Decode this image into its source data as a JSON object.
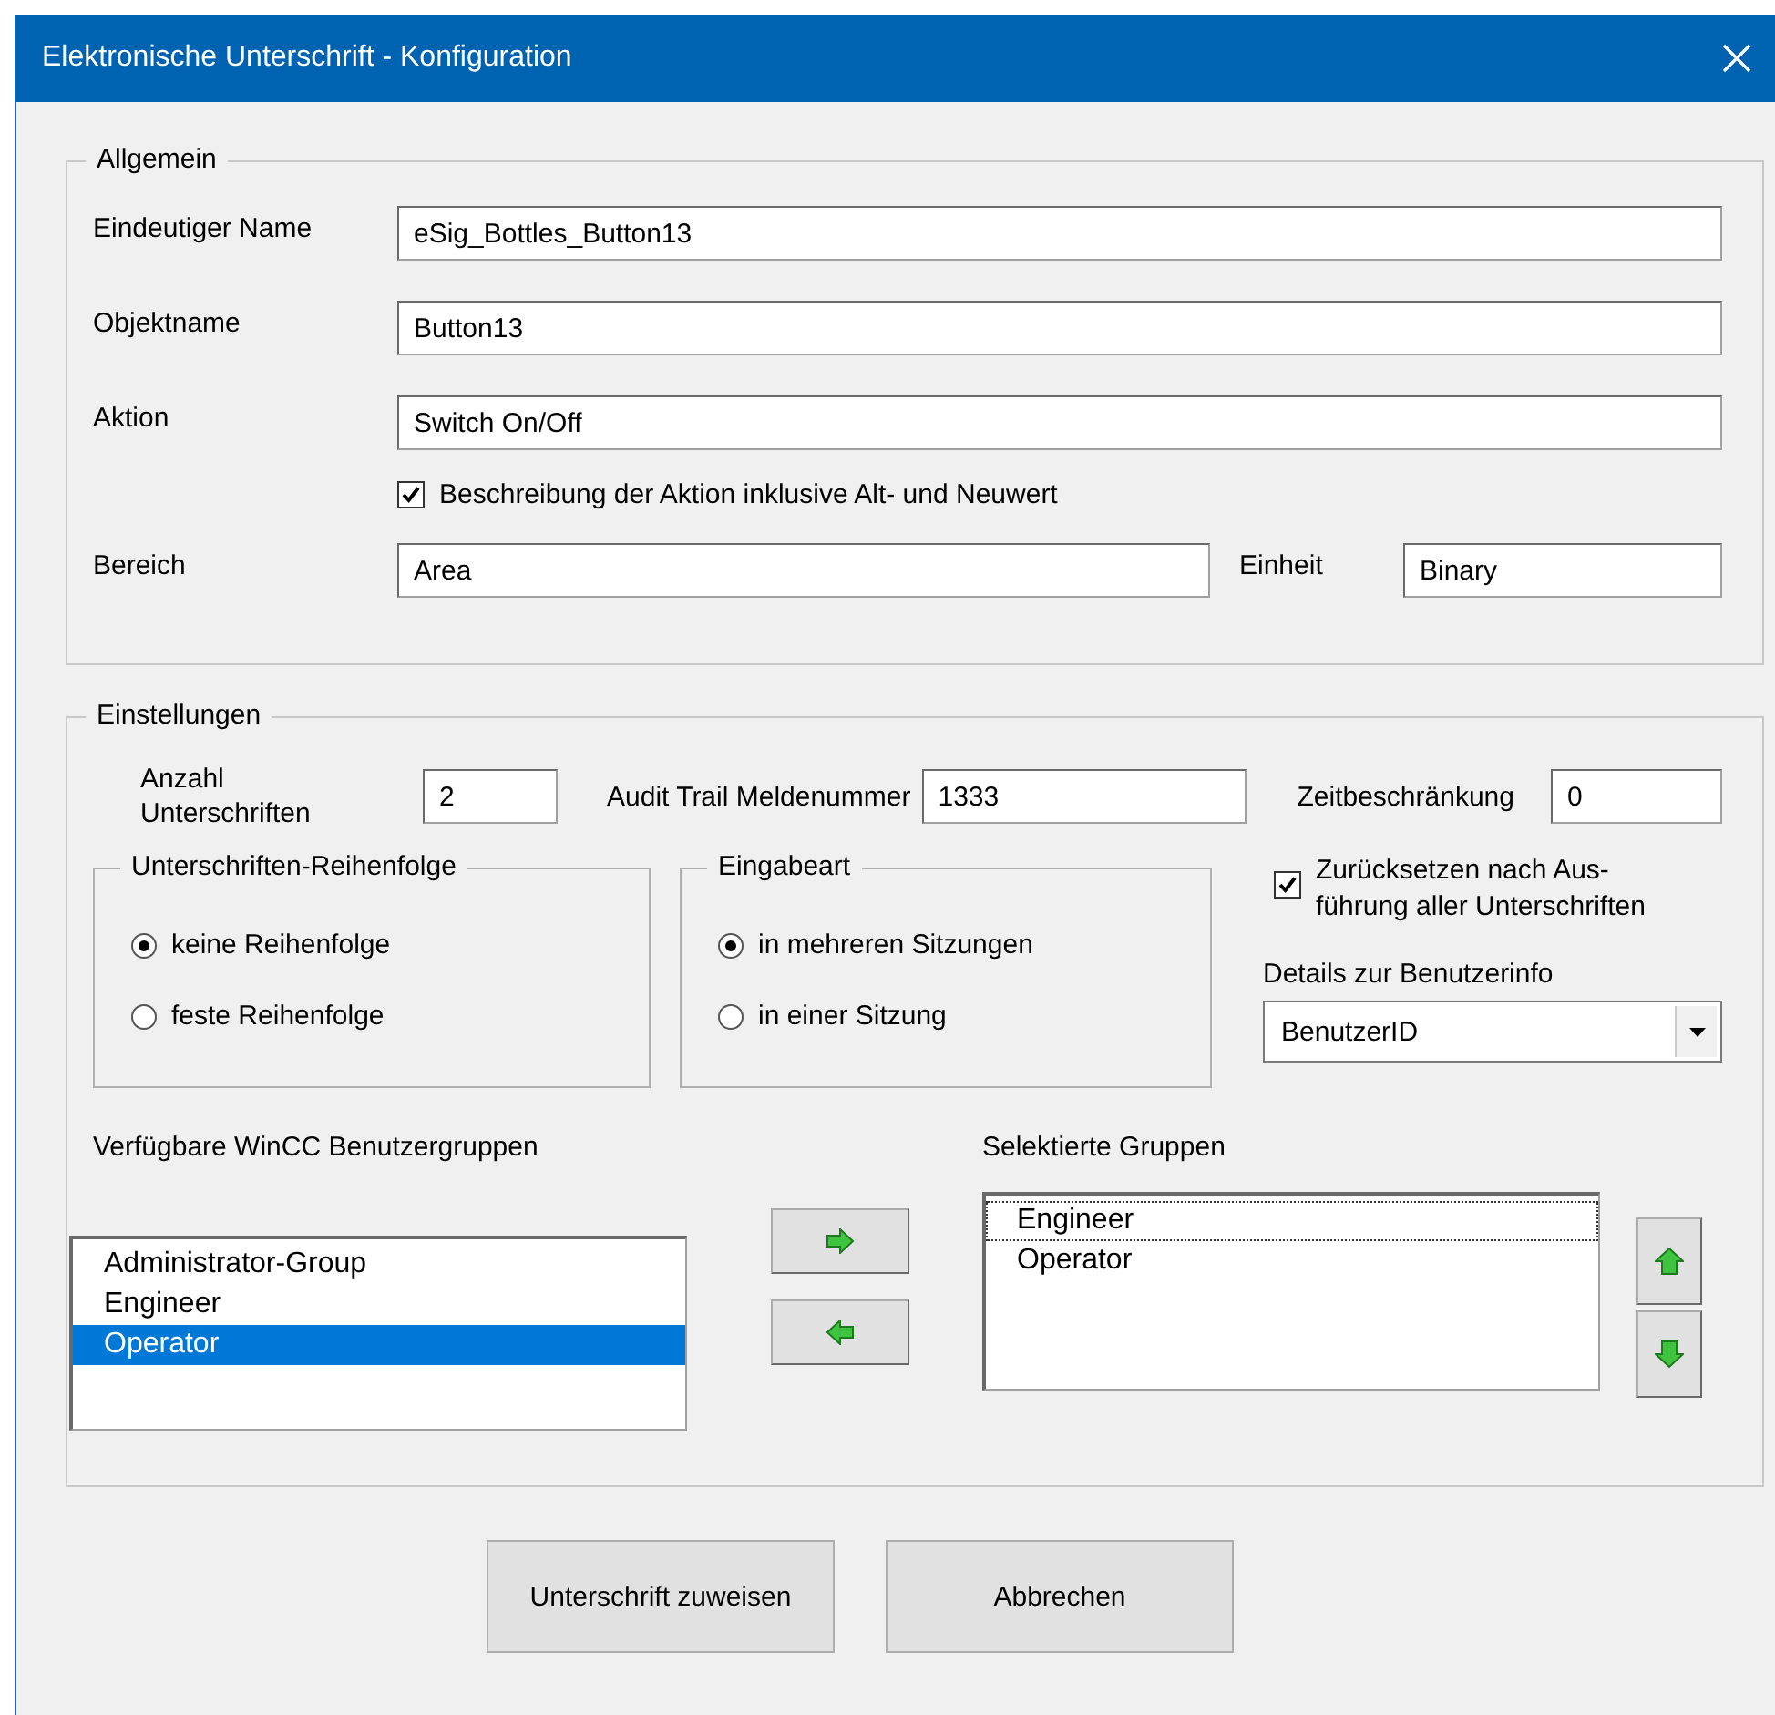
{
  "window": {
    "title": "Elektronische Unterschrift - Konfiguration"
  },
  "general": {
    "legend": "Allgemein",
    "fields": [
      {
        "label": "Eindeutiger Name",
        "value": "eSig_Bottles_Button13"
      },
      {
        "label": "Objektname",
        "value": "Button13"
      },
      {
        "label": "Aktion",
        "value": "Switch On/Off"
      }
    ],
    "description_option": {
      "label": "Beschreibung der Aktion inklusive Alt- und Neuwert",
      "checked": true
    },
    "area": {
      "label": "Bereich",
      "value": "Area"
    },
    "unit": {
      "label": "Einheit",
      "value": "Binary"
    }
  },
  "settings": {
    "legend": "Einstellungen",
    "signature_count": {
      "label": "Anzahl Unterschriften",
      "value": "2"
    },
    "audit_number": {
      "label": "Audit Trail Meldenummer",
      "value": "1333"
    },
    "time_limit": {
      "label": "Zeitbeschränkung",
      "value": "0"
    },
    "signature_order": {
      "legend": "Unterschriften-Reihenfolge",
      "options": [
        {
          "label": "keine Reihenfolge",
          "selected": true
        },
        {
          "label": "feste Reihenfolge",
          "selected": false
        }
      ]
    },
    "input_mode": {
      "legend": "Eingabeart",
      "options": [
        {
          "label": "in mehreren Sitzungen",
          "selected": true
        },
        {
          "label": "in einer Sitzung",
          "selected": false
        }
      ]
    },
    "reset_option": {
      "label": "Zurücksetzen nach Aus-\nführung aller Unterschriften",
      "checked": true
    },
    "user_info": {
      "label": "Details zur Benutzerinfo",
      "value": "BenutzerID"
    },
    "available_groups": {
      "label": "Verfügbare WinCC Benutzergruppen",
      "items": [
        {
          "label": "Administrator-Group",
          "selected": false
        },
        {
          "label": "Engineer",
          "selected": false
        },
        {
          "label": "Operator",
          "selected": true
        }
      ]
    },
    "selected_groups": {
      "label": "Selektierte Gruppen",
      "items": [
        {
          "label": "Engineer",
          "focused": true
        },
        {
          "label": "Operator",
          "focused": false
        }
      ]
    }
  },
  "buttons": [
    {
      "label": "Unterschrift zuweisen"
    },
    {
      "label": "Abbrechen"
    }
  ]
}
